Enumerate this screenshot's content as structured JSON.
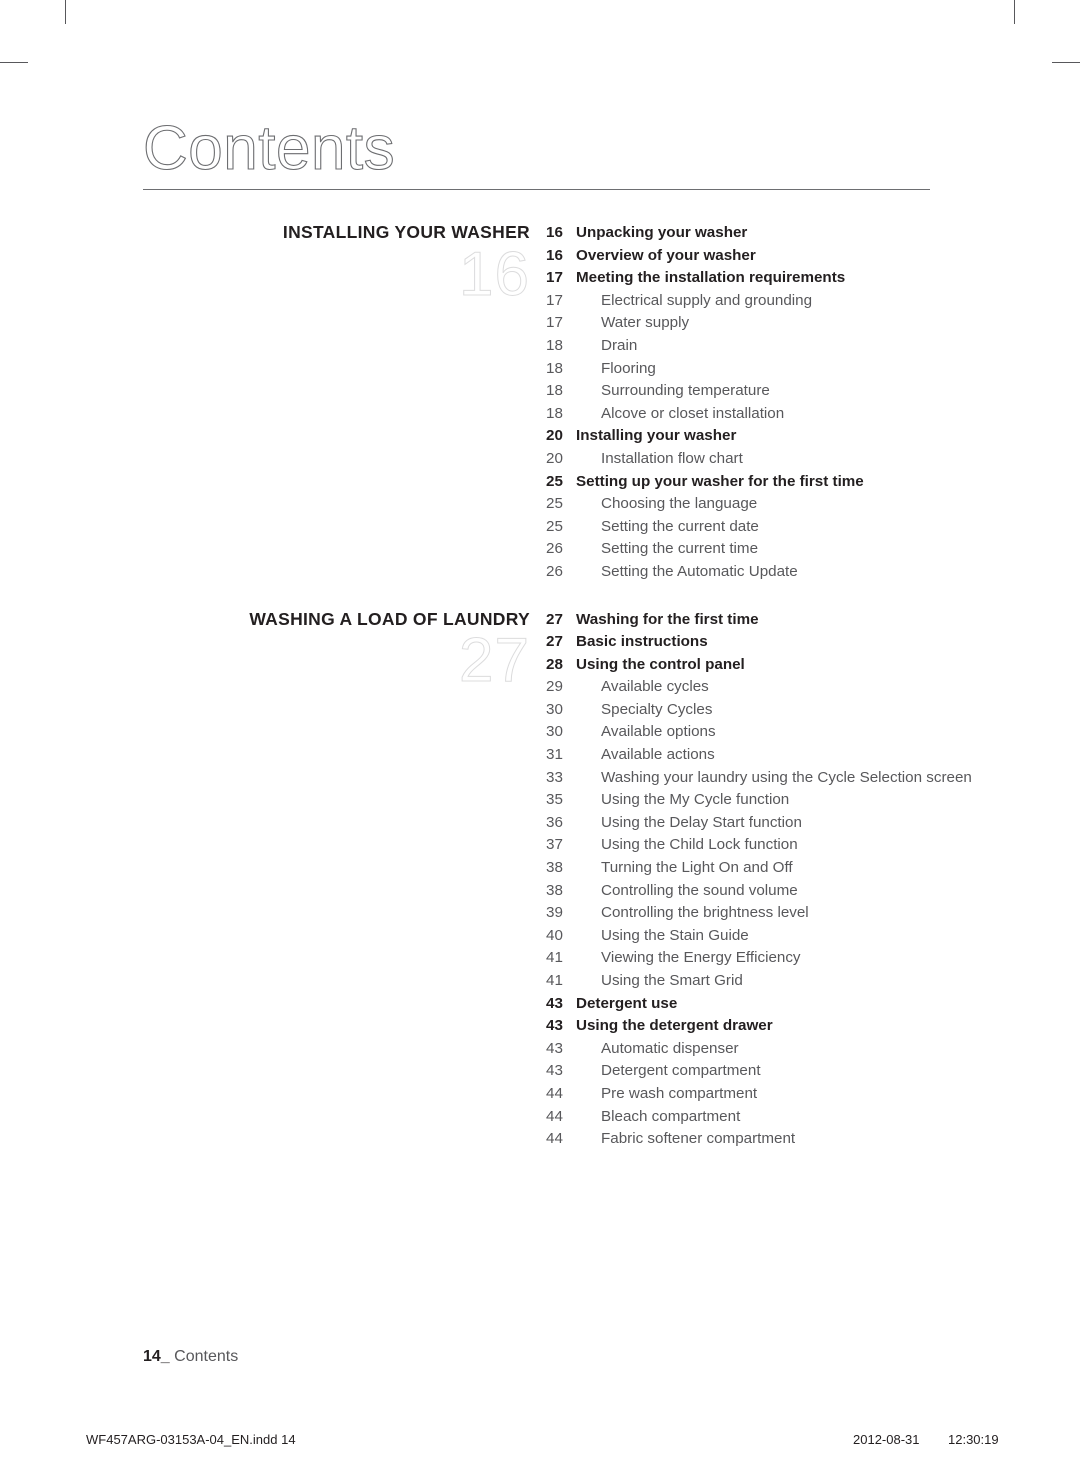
{
  "header": {
    "title": "Contents"
  },
  "sections": [
    {
      "title": "INSTALLING YOUR WASHER",
      "number": "16",
      "entries": [
        {
          "page": "16",
          "label": "Unpacking your washer",
          "level": 1
        },
        {
          "page": "16",
          "label": "Overview of your washer",
          "level": 1
        },
        {
          "page": "17",
          "label": "Meeting the installation requirements",
          "level": 1
        },
        {
          "page": "17",
          "label": "Electrical supply and grounding",
          "level": 2
        },
        {
          "page": "17",
          "label": "Water supply",
          "level": 2
        },
        {
          "page": "18",
          "label": "Drain",
          "level": 2
        },
        {
          "page": "18",
          "label": "Flooring",
          "level": 2
        },
        {
          "page": "18",
          "label": "Surrounding temperature",
          "level": 2
        },
        {
          "page": "18",
          "label": "Alcove or closet installation",
          "level": 2
        },
        {
          "page": "20",
          "label": "Installing your washer",
          "level": 1
        },
        {
          "page": "20",
          "label": "Installation flow chart",
          "level": 2
        },
        {
          "page": "25",
          "label": "Setting up your washer for the first time",
          "level": 1
        },
        {
          "page": "25",
          "label": "Choosing the language",
          "level": 2
        },
        {
          "page": "25",
          "label": "Setting the current date",
          "level": 2
        },
        {
          "page": "26",
          "label": "Setting the current time",
          "level": 2
        },
        {
          "page": "26",
          "label": "Setting the Automatic Update",
          "level": 2
        }
      ]
    },
    {
      "title": "WASHING A LOAD OF LAUNDRY",
      "number": "27",
      "entries": [
        {
          "page": "27",
          "label": "Washing for the first time",
          "level": 1
        },
        {
          "page": "27",
          "label": "Basic instructions",
          "level": 1
        },
        {
          "page": "28",
          "label": "Using the control panel",
          "level": 1
        },
        {
          "page": "29",
          "label": "Available cycles",
          "level": 2
        },
        {
          "page": "30",
          "label": "Specialty Cycles",
          "level": 2
        },
        {
          "page": "30",
          "label": "Available options",
          "level": 2
        },
        {
          "page": "31",
          "label": "Available actions",
          "level": 2
        },
        {
          "page": "33",
          "label": "Washing your laundry using the Cycle Selection screen",
          "level": 2
        },
        {
          "page": "35",
          "label": "Using the My Cycle function",
          "level": 2
        },
        {
          "page": "36",
          "label": "Using the Delay Start function",
          "level": 2
        },
        {
          "page": "37",
          "label": "Using the Child Lock function",
          "level": 2
        },
        {
          "page": "38",
          "label": "Turning the Light On and Off",
          "level": 2
        },
        {
          "page": "38",
          "label": "Controlling the sound volume",
          "level": 2
        },
        {
          "page": "39",
          "label": "Controlling the brightness level",
          "level": 2
        },
        {
          "page": "40",
          "label": "Using the Stain Guide",
          "level": 2
        },
        {
          "page": "41",
          "label": "Viewing the Energy Efficiency",
          "level": 2
        },
        {
          "page": "41",
          "label": "Using the Smart Grid",
          "level": 2
        },
        {
          "page": "43",
          "label": "Detergent use",
          "level": 1
        },
        {
          "page": "43",
          "label": "Using the detergent drawer",
          "level": 1
        },
        {
          "page": "43",
          "label": "Automatic dispenser",
          "level": 2
        },
        {
          "page": "43",
          "label": "Detergent compartment",
          "level": 2
        },
        {
          "page": "44",
          "label": "Pre wash compartment",
          "level": 2
        },
        {
          "page": "44",
          "label": "Bleach compartment",
          "level": 2
        },
        {
          "page": "44",
          "label": "Fabric softener compartment",
          "level": 2
        }
      ]
    }
  ],
  "footer": {
    "folio": "14_",
    "label": "Contents"
  },
  "slug": {
    "file": "WF457ARG-03153A-04_EN.indd   14",
    "date": "2012-08-31",
    "time": "12:30:19"
  }
}
